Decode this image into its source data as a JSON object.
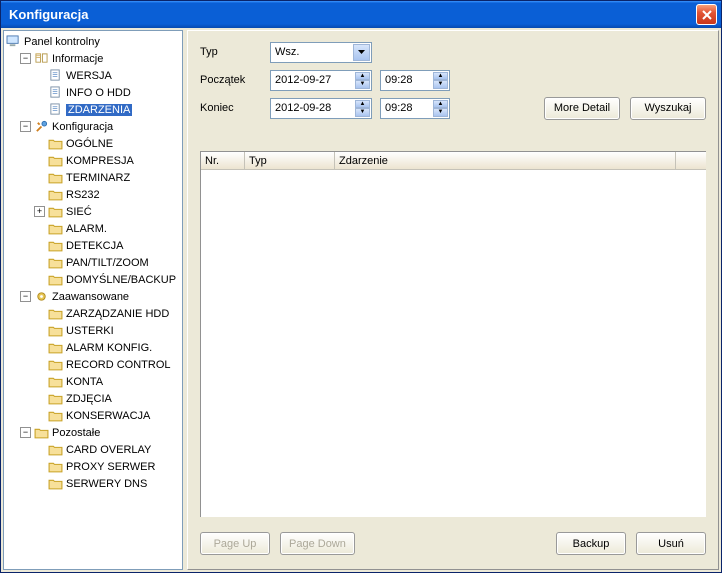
{
  "window": {
    "title": "Konfiguracja"
  },
  "tree": {
    "root": "Panel kontrolny",
    "informacje": {
      "label": "Informacje",
      "wersja": "WERSJA",
      "info_o_hdd": "INFO O HDD",
      "zdarzenia": "ZDARZENIA"
    },
    "konfiguracja": {
      "label": "Konfiguracja",
      "ogolne": "OGÓLNE",
      "kompresja": "KOMPRESJA",
      "terminarz": "TERMINARZ",
      "rs232": "RS232",
      "siec": "SIEĆ",
      "alarm": "ALARM.",
      "detekcja": "DETEKCJA",
      "ptz": "PAN/TILT/ZOOM",
      "domyslne": "DOMYŚLNE/BACKUP"
    },
    "zaawansowane": {
      "label": "Zaawansowane",
      "zarz_hdd": "ZARZĄDZANIE HDD",
      "usterki": "USTERKI",
      "alarm_konfig": "ALARM KONFIG.",
      "record_control": "RECORD CONTROL",
      "konta": "KONTA",
      "zdjecia": "ZDJĘCIA",
      "konserwacja": "KONSERWACJA"
    },
    "pozostale": {
      "label": "Pozostałe",
      "card_overlay": "CARD OVERLAY",
      "proxy_serwer": "PROXY SERWER",
      "serwery_dns": "SERWERY DNS"
    }
  },
  "form": {
    "typ_label": "Typ",
    "typ_value": "Wsz.",
    "poczatek_label": "Początek",
    "poczatek_date": "2012-09-27",
    "poczatek_time": "09:28",
    "koniec_label": "Koniec",
    "koniec_date": "2012-09-28",
    "koniec_time": "09:28"
  },
  "buttons": {
    "more_detail": "More Detail",
    "wyszukaj": "Wyszukaj",
    "page_up": "Page Up",
    "page_down": "Page Down",
    "backup": "Backup",
    "usun": "Usuń"
  },
  "table": {
    "col_nr": "Nr.",
    "col_typ": "Typ",
    "col_zdarzenie": "Zdarzenie"
  }
}
